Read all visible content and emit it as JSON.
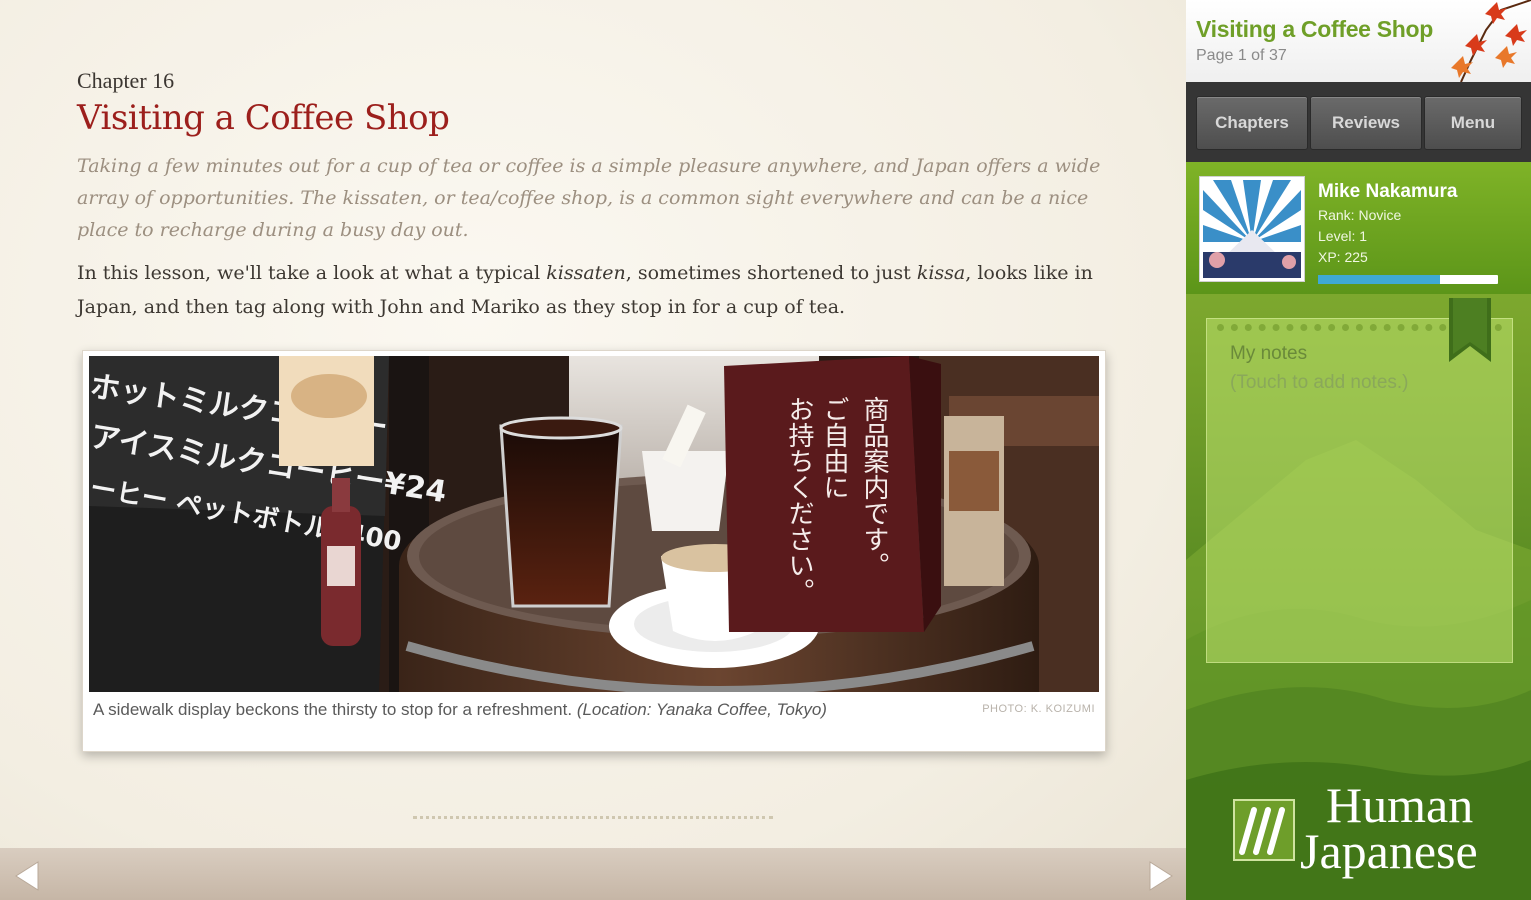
{
  "lesson": {
    "chapter_label": "Chapter 16",
    "title": "Visiting a Coffee Shop",
    "intro": "Taking a few minutes out for a cup of tea or coffee is a simple pleasure anywhere, and Japan offers a wide array of opportunities. The kissaten, or tea/coffee shop, is a common sight everywhere and can be a nice place to recharge during a busy day out.",
    "body_part1": "In this lesson, we'll take a look at what a typical ",
    "body_em1": "kissaten",
    "body_part2": ", sometimes shortened to just ",
    "body_em2": "kissa",
    "body_part3": ", looks like in Japan, and then tag along with John and Mariko as they stop in for a cup of tea."
  },
  "figure": {
    "caption": "A sidewalk display beckons the thirsty to stop for a refreshment.",
    "caption_location": "(Location: Yanaka Coffee, Tokyo)",
    "credit": "PHOTO: K. KOIZUMI",
    "chalkboard_lines": [
      "ホットミルクコーヒー",
      "アイスミルクコーヒー¥24",
      "ーヒー ペットボトル¥400"
    ],
    "sign_line1": "商品案内です。",
    "sign_line2": "ご自由に",
    "sign_line3": "お持ちください。"
  },
  "sidebar": {
    "title": "Visiting a Coffee Shop",
    "page_indicator": "Page 1 of 37",
    "tabs": [
      {
        "label": "Chapters"
      },
      {
        "label": "Reviews"
      },
      {
        "label": "Menu"
      }
    ],
    "profile": {
      "name": "Mike Nakamura",
      "rank": "Rank: Novice",
      "level": "Level: 1",
      "xp": "XP: 225",
      "xp_progress": 0.68
    },
    "notes": {
      "title": "My notes",
      "hint": "(Touch to add notes.)"
    },
    "logo_line1": "Human",
    "logo_line2": "Japanese"
  },
  "colors": {
    "chapter_title": "#9c1f1c",
    "sidebar_green": "#76a22b",
    "xp_bar": "#3fa9d4"
  },
  "icons": {
    "prev": "triangle-left-icon",
    "next": "triangle-right-icon"
  }
}
